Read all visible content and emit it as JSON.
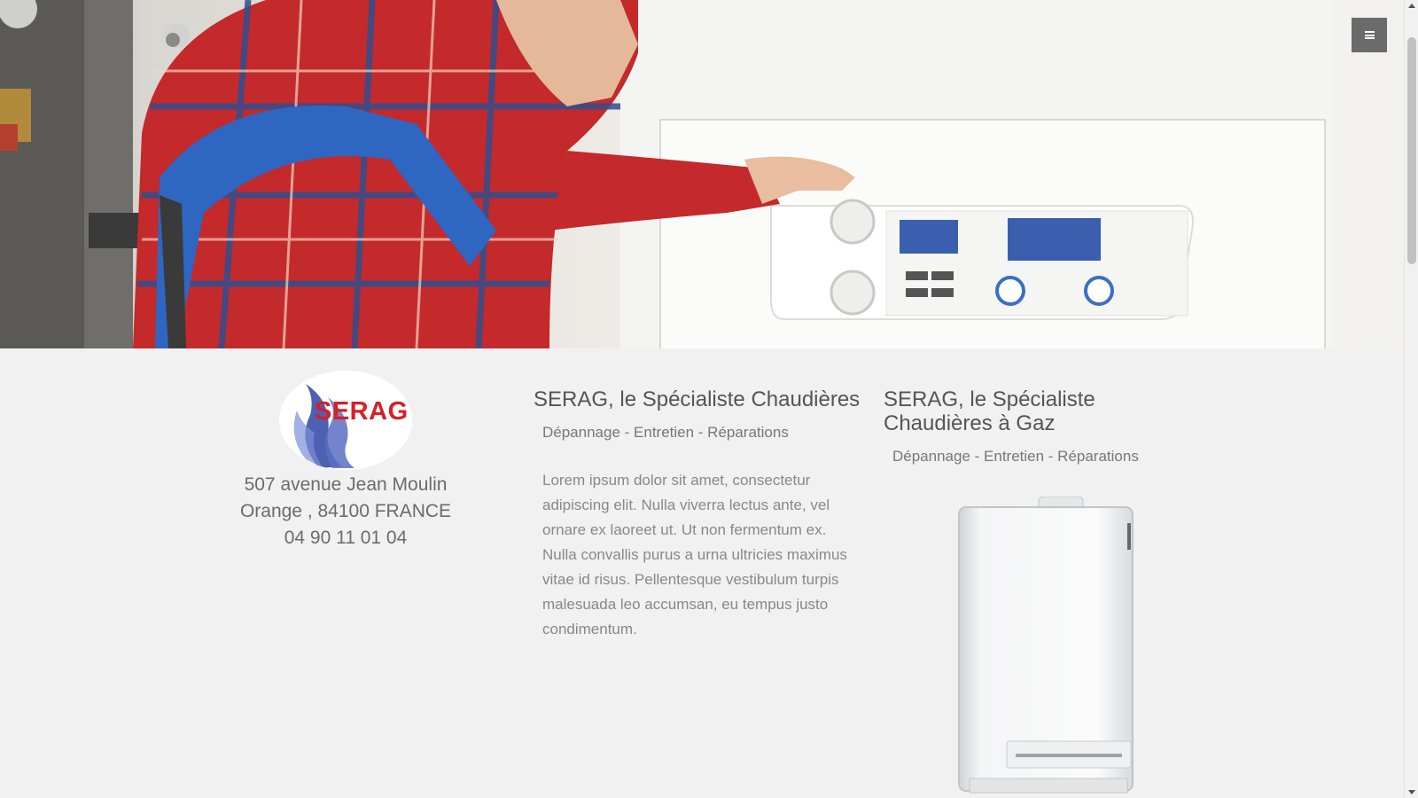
{
  "hero": {
    "image": "technician-adjusting-boiler-photo",
    "menu_icon": "hamburger-menu-icon"
  },
  "brand": {
    "logo_text": "SERAG",
    "logo_color": "#d4202a",
    "flame_color": "#3a4fa8"
  },
  "contact": {
    "street": "507 avenue Jean Moulin",
    "city": "Orange , 84100 FRANCE",
    "phone": "04 90 11 01 04"
  },
  "section_middle": {
    "title": "SERAG, le Spécialiste Chaudières",
    "subtitle": "Dépannage - Entretien - Réparations",
    "body": "Lorem ipsum dolor sit amet, consectetur adipiscing elit. Nulla viverra lectus ante, vel ornare ex laoreet ut. Ut non fermentum ex. Nulla convallis purus a urna ultricies maximus vitae id risus. Pellentesque vestibulum turpis malesuada leo accumsan, eu tempus justo condimentum."
  },
  "section_right": {
    "title": "SERAG, le Spécialiste Chaudières à Gaz",
    "subtitle": "Dépannage - Entretien - Réparations",
    "image": "wall-mounted-gas-boiler-image"
  }
}
